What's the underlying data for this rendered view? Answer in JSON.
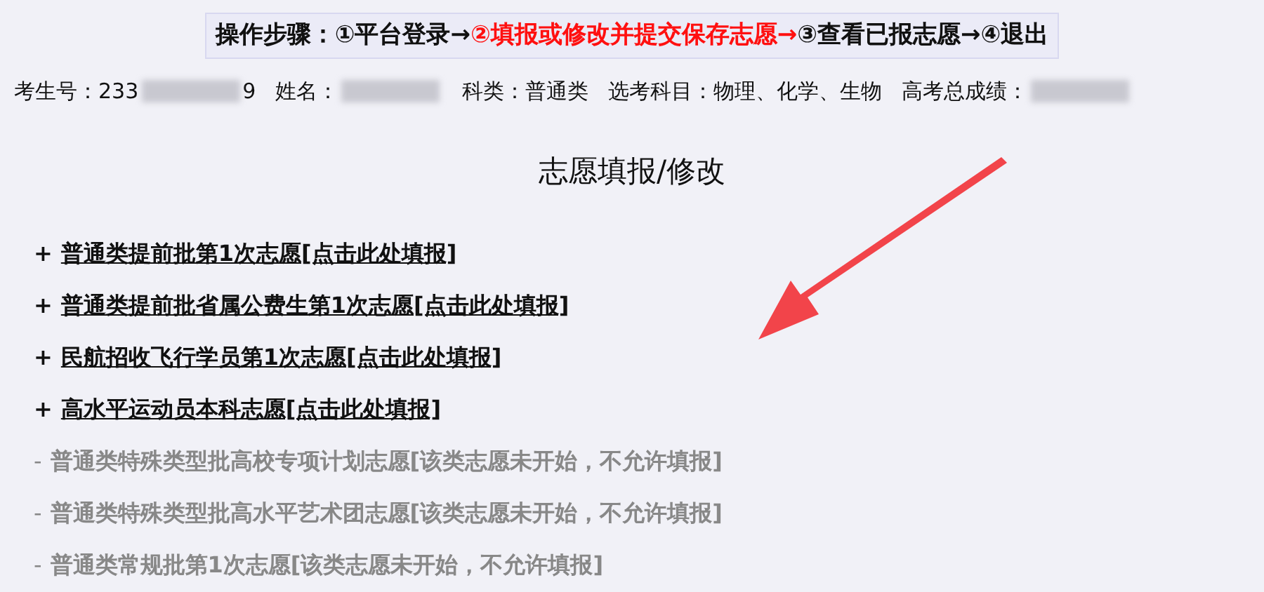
{
  "steps": {
    "label": "操作步骤：",
    "items": [
      {
        "text": "①平台登录→",
        "selected": false
      },
      {
        "text": "②填报或修改并提交保存志愿→",
        "selected": true
      },
      {
        "text": "③查看已报志愿→",
        "selected": false
      },
      {
        "text": "④退出",
        "selected": false
      }
    ]
  },
  "student_info": [
    {
      "label": "考生号：",
      "value": "233",
      "value_end": "9",
      "blurred": true
    },
    {
      "label": "姓名：",
      "blurred": true
    },
    {
      "label": "科类：",
      "value": "普通类",
      "blurred": false
    },
    {
      "label": "选考科目：",
      "value": "物理、化学、生物",
      "blurred": false
    },
    {
      "label": "高考总成绩：",
      "blurred": true
    }
  ],
  "title": "志愿填报/修改",
  "applications": [
    {
      "kind": "open",
      "marker": "+",
      "text": "普通类提前批第1次志愿[点击此处填报]"
    },
    {
      "kind": "open",
      "marker": "+",
      "text": "普通类提前批省属公费生第1次志愿[点击此处填报]"
    },
    {
      "kind": "open",
      "marker": "+",
      "text": "民航招收飞行学员第1次志愿[点击此处填报]"
    },
    {
      "kind": "open",
      "marker": "+",
      "text": "高水平运动员本科志愿[点击此处填报]"
    },
    {
      "kind": "closed",
      "marker": "-",
      "text": "普通类特殊类型批高校专项计划志愿[该类志愿未开始，不允许填报]"
    },
    {
      "kind": "closed",
      "marker": "-",
      "text": "普通类特殊类型批高水平艺术团志愿[该类志愿未开始，不允许填报]"
    },
    {
      "kind": "closed",
      "marker": "-",
      "text": "普通类常规批第1次志愿[该类志愿未开始，不允许填报]"
    }
  ]
}
